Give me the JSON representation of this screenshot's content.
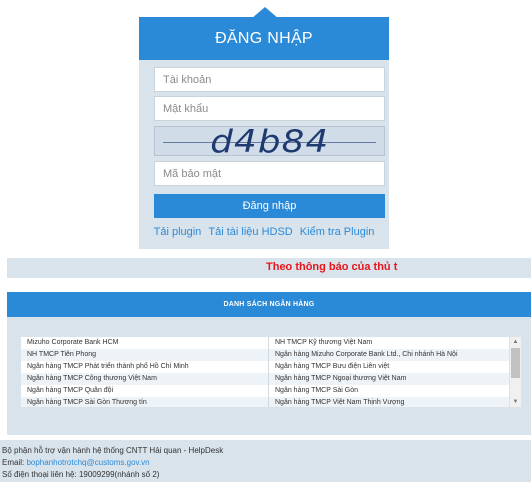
{
  "login": {
    "title": "ĐĂNG NHẬP",
    "username_placeholder": "Tài khoản",
    "password_placeholder": "Mật khẩu",
    "captcha_text": "d4b84",
    "captcha_placeholder": "Mã bảo mật",
    "submit_label": "Đăng nhập",
    "links": [
      "Tải plugin",
      "Tải tài liệu HDSD",
      "Kiểm tra Plugin"
    ]
  },
  "marquee": {
    "text": "Theo thông báo của thủ t"
  },
  "banks": {
    "title": "DANH SÁCH NGÂN HÀNG",
    "rows": [
      [
        "Mizuho Corporate Bank HCM",
        "NH TMCP Kỹ thương Việt Nam"
      ],
      [
        "NH TMCP Tiên Phong",
        "Ngân hàng Mizuho Corporate Bank Ltd., Chi nhánh Hà Nội"
      ],
      [
        "Ngân hàng TMCP Phát triển thành phố Hồ Chí Minh",
        "Ngân hàng TMCP Bưu điện Liên việt"
      ],
      [
        "Ngân hàng TMCP Công thương Việt Nam",
        "Ngân hàng TMCP Ngoại thương Việt Nam"
      ],
      [
        "Ngân hàng TMCP Quân đội",
        "Ngân hàng TMCP Sài Gòn"
      ],
      [
        "Ngân hàng TMCP Sài Gòn Thương tín",
        "Ngân hàng TMCP Việt Nam Thịnh Vượng"
      ]
    ]
  },
  "footer": {
    "line1": "Bộ phận hỗ trợ vận hành hệ thống CNTT Hải quan - HelpDesk",
    "email_label": "Email: ",
    "email": "bophanhotrotchq@customs.gov.vn",
    "phone": "Số điện thoại liên hệ: 19009299(nhánh số 2)"
  }
}
